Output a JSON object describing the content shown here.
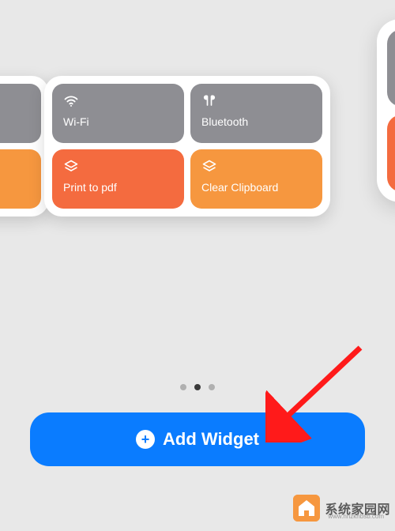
{
  "widget": {
    "tiles": [
      {
        "label": "Wi-Fi",
        "icon": "wifi",
        "color": "gray"
      },
      {
        "label": "Bluetooth",
        "icon": "airpods",
        "color": "gray"
      },
      {
        "label": "Print to pdf",
        "icon": "layers",
        "color": "orange1"
      },
      {
        "label": "Clear Clipboard",
        "icon": "layers",
        "color": "orange2"
      }
    ]
  },
  "pagination": {
    "count": 3,
    "active_index": 1
  },
  "add_button": {
    "label": "Add Widget"
  },
  "watermark": {
    "text": "系统家园网",
    "url": "www.hnzkhbsb.com"
  },
  "colors": {
    "tile_gray": "#8e8e93",
    "tile_orange1": "#f46b3f",
    "tile_orange2": "#f6973f",
    "button_blue": "#0a7cff",
    "arrow_red": "#ff1a1a"
  }
}
